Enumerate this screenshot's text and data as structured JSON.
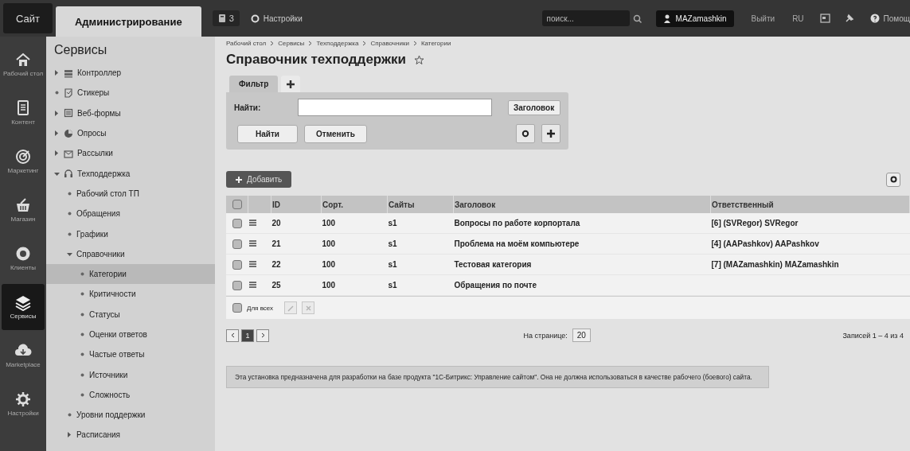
{
  "topbar": {
    "tabs": [
      {
        "label": "Сайт",
        "selected": false
      },
      {
        "label": "Администрирование",
        "selected": true
      }
    ],
    "notifications": {
      "count": "3"
    },
    "settings_link": "Настройки",
    "search": {
      "placeholder": "поиск..."
    },
    "user": "MAZamashkin",
    "logout": "Выйти",
    "language": "RU",
    "help": "Помощ"
  },
  "rail": {
    "items": [
      {
        "label": "Рабочий стол",
        "selected": false
      },
      {
        "label": "Контент",
        "selected": false
      },
      {
        "label": "Маркетинг",
        "selected": false
      },
      {
        "label": "Магазин",
        "selected": false
      },
      {
        "label": "Клиенты",
        "selected": false
      },
      {
        "label": "Сервисы",
        "selected": true
      },
      {
        "label": "Marketplace",
        "selected": false
      },
      {
        "label": "Настройки",
        "selected": false
      }
    ]
  },
  "menu": {
    "title": "Сервисы",
    "items": [
      {
        "label": "Контроллер",
        "kind": "folder",
        "expanded": false,
        "selected": false
      },
      {
        "label": "Стикеры",
        "kind": "leaf",
        "selected": false
      },
      {
        "label": "Веб-формы",
        "kind": "folder",
        "expanded": false,
        "selected": false
      },
      {
        "label": "Опросы",
        "kind": "folder",
        "expanded": false,
        "selected": false
      },
      {
        "label": "Рассылки",
        "kind": "folder",
        "expanded": false,
        "selected": false
      },
      {
        "label": "Техподдержка",
        "kind": "folder",
        "expanded": true,
        "selected": false,
        "children": [
          {
            "label": "Рабочий стол ТП",
            "kind": "leaf",
            "selected": false
          },
          {
            "label": "Обращения",
            "kind": "leaf",
            "selected": false
          },
          {
            "label": "Графики",
            "kind": "leaf",
            "selected": false
          },
          {
            "label": "Справочники",
            "kind": "folder",
            "expanded": true,
            "selected": false,
            "children": [
              {
                "label": "Категории",
                "kind": "leaf",
                "selected": true
              },
              {
                "label": "Критичности",
                "kind": "leaf",
                "selected": false
              },
              {
                "label": "Статусы",
                "kind": "leaf",
                "selected": false
              },
              {
                "label": "Оценки ответов",
                "kind": "leaf",
                "selected": false
              },
              {
                "label": "Частые ответы",
                "kind": "leaf",
                "selected": false
              },
              {
                "label": "Источники",
                "kind": "leaf",
                "selected": false
              },
              {
                "label": "Сложность",
                "kind": "leaf",
                "selected": false
              }
            ]
          },
          {
            "label": "Уровни поддержки",
            "kind": "leaf",
            "selected": false
          },
          {
            "label": "Расписания",
            "kind": "folder",
            "expanded": false,
            "selected": false
          }
        ]
      }
    ]
  },
  "main": {
    "breadcrumbs": [
      "Рабочий стол",
      "Сервисы",
      "Техподдержка",
      "Справочники",
      "Категории"
    ],
    "title": "Справочник техподдержки",
    "filter": {
      "tabs": [
        {
          "label": "Фильтр",
          "selected": true
        }
      ],
      "find_label": "Найти:",
      "field_select": "Заголовок",
      "buttons": [
        "Найти",
        "Отменить"
      ]
    },
    "add_button": "Добавить",
    "table": {
      "header_checked": false,
      "columns": [
        "ID",
        "Сорт.",
        "Сайты",
        "Заголовок",
        "Ответственный"
      ],
      "rows": [
        {
          "checked": false,
          "id": "20",
          "sort": "100",
          "sites": "s1",
          "title": "Вопросы по работе корпортала",
          "responsible": "[6] (SVRegor) SVRegor"
        },
        {
          "checked": false,
          "id": "21",
          "sort": "100",
          "sites": "s1",
          "title": "Проблема на моём компьютере",
          "responsible": "[4] (AAPashkov) AAPashkov"
        },
        {
          "checked": false,
          "id": "22",
          "sort": "100",
          "sites": "s1",
          "title": "Тестовая категория",
          "responsible": "[7] (MAZamashkin) MAZamashkin"
        },
        {
          "checked": false,
          "id": "25",
          "sort": "100",
          "sites": "s1",
          "title": "Обращения по почте"
        }
      ],
      "footer": {
        "for_all_label": "Для всех",
        "checked": false,
        "actions": [
          {
            "kind": "edit",
            "disabled": true
          },
          {
            "kind": "delete",
            "disabled": true
          }
        ]
      }
    },
    "pagination": {
      "pages": [
        {
          "label": "1",
          "selected": true
        }
      ],
      "per_page_label": "На странице:",
      "per_page": "20",
      "records": "Записей 1 – 4 из 4"
    },
    "notice": "Эта установка предназначена для разработки на базе продукта \"1С-Битрикс: Управление сайтом\". Она не должна использоваться в качестве рабочего (боевого) сайта."
  }
}
